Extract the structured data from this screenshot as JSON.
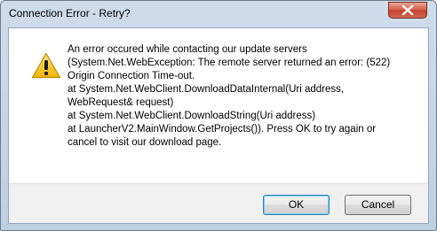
{
  "window": {
    "title": "Connection Error - Retry?"
  },
  "icons": {
    "close": "close-icon",
    "warning": "warning-icon"
  },
  "dialog": {
    "message": "An error occured while contacting our update servers\n(System.Net.WebException: The remote server returned an error: (522)\nOrigin Connection Time-out.\n   at System.Net.WebClient.DownloadDataInternal(Uri address,\nWebRequest& request)\n   at System.Net.WebClient.DownloadString(Uri address)\n   at LauncherV2.MainWindow.GetProjects()).  Press OK to try again or\ncancel to visit our download page."
  },
  "buttons": {
    "ok_label": "OK",
    "cancel_label": "Cancel"
  },
  "colors": {
    "warning_yellow": "#f7c300",
    "close_red": "#c3412c",
    "default_button_border": "#3c7fb1"
  }
}
